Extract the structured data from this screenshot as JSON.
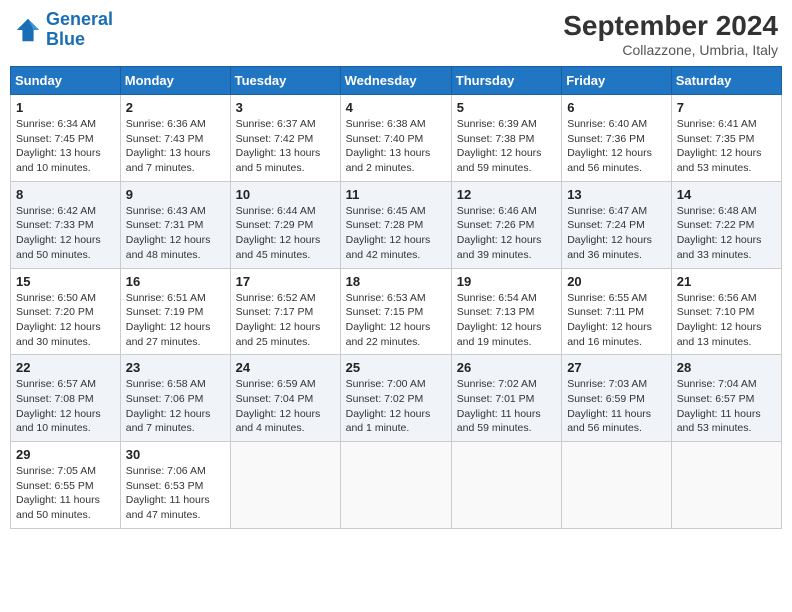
{
  "header": {
    "logo_line1": "General",
    "logo_line2": "Blue",
    "month": "September 2024",
    "location": "Collazzone, Umbria, Italy"
  },
  "days_of_week": [
    "Sunday",
    "Monday",
    "Tuesday",
    "Wednesday",
    "Thursday",
    "Friday",
    "Saturday"
  ],
  "weeks": [
    [
      {
        "day": "1",
        "sunrise": "6:34 AM",
        "sunset": "7:45 PM",
        "daylight": "13 hours and 10 minutes."
      },
      {
        "day": "2",
        "sunrise": "6:36 AM",
        "sunset": "7:43 PM",
        "daylight": "13 hours and 7 minutes."
      },
      {
        "day": "3",
        "sunrise": "6:37 AM",
        "sunset": "7:42 PM",
        "daylight": "13 hours and 5 minutes."
      },
      {
        "day": "4",
        "sunrise": "6:38 AM",
        "sunset": "7:40 PM",
        "daylight": "13 hours and 2 minutes."
      },
      {
        "day": "5",
        "sunrise": "6:39 AM",
        "sunset": "7:38 PM",
        "daylight": "12 hours and 59 minutes."
      },
      {
        "day": "6",
        "sunrise": "6:40 AM",
        "sunset": "7:36 PM",
        "daylight": "12 hours and 56 minutes."
      },
      {
        "day": "7",
        "sunrise": "6:41 AM",
        "sunset": "7:35 PM",
        "daylight": "12 hours and 53 minutes."
      }
    ],
    [
      {
        "day": "8",
        "sunrise": "6:42 AM",
        "sunset": "7:33 PM",
        "daylight": "12 hours and 50 minutes."
      },
      {
        "day": "9",
        "sunrise": "6:43 AM",
        "sunset": "7:31 PM",
        "daylight": "12 hours and 48 minutes."
      },
      {
        "day": "10",
        "sunrise": "6:44 AM",
        "sunset": "7:29 PM",
        "daylight": "12 hours and 45 minutes."
      },
      {
        "day": "11",
        "sunrise": "6:45 AM",
        "sunset": "7:28 PM",
        "daylight": "12 hours and 42 minutes."
      },
      {
        "day": "12",
        "sunrise": "6:46 AM",
        "sunset": "7:26 PM",
        "daylight": "12 hours and 39 minutes."
      },
      {
        "day": "13",
        "sunrise": "6:47 AM",
        "sunset": "7:24 PM",
        "daylight": "12 hours and 36 minutes."
      },
      {
        "day": "14",
        "sunrise": "6:48 AM",
        "sunset": "7:22 PM",
        "daylight": "12 hours and 33 minutes."
      }
    ],
    [
      {
        "day": "15",
        "sunrise": "6:50 AM",
        "sunset": "7:20 PM",
        "daylight": "12 hours and 30 minutes."
      },
      {
        "day": "16",
        "sunrise": "6:51 AM",
        "sunset": "7:19 PM",
        "daylight": "12 hours and 27 minutes."
      },
      {
        "day": "17",
        "sunrise": "6:52 AM",
        "sunset": "7:17 PM",
        "daylight": "12 hours and 25 minutes."
      },
      {
        "day": "18",
        "sunrise": "6:53 AM",
        "sunset": "7:15 PM",
        "daylight": "12 hours and 22 minutes."
      },
      {
        "day": "19",
        "sunrise": "6:54 AM",
        "sunset": "7:13 PM",
        "daylight": "12 hours and 19 minutes."
      },
      {
        "day": "20",
        "sunrise": "6:55 AM",
        "sunset": "7:11 PM",
        "daylight": "12 hours and 16 minutes."
      },
      {
        "day": "21",
        "sunrise": "6:56 AM",
        "sunset": "7:10 PM",
        "daylight": "12 hours and 13 minutes."
      }
    ],
    [
      {
        "day": "22",
        "sunrise": "6:57 AM",
        "sunset": "7:08 PM",
        "daylight": "12 hours and 10 minutes."
      },
      {
        "day": "23",
        "sunrise": "6:58 AM",
        "sunset": "7:06 PM",
        "daylight": "12 hours and 7 minutes."
      },
      {
        "day": "24",
        "sunrise": "6:59 AM",
        "sunset": "7:04 PM",
        "daylight": "12 hours and 4 minutes."
      },
      {
        "day": "25",
        "sunrise": "7:00 AM",
        "sunset": "7:02 PM",
        "daylight": "12 hours and 1 minute."
      },
      {
        "day": "26",
        "sunrise": "7:02 AM",
        "sunset": "7:01 PM",
        "daylight": "11 hours and 59 minutes."
      },
      {
        "day": "27",
        "sunrise": "7:03 AM",
        "sunset": "6:59 PM",
        "daylight": "11 hours and 56 minutes."
      },
      {
        "day": "28",
        "sunrise": "7:04 AM",
        "sunset": "6:57 PM",
        "daylight": "11 hours and 53 minutes."
      }
    ],
    [
      {
        "day": "29",
        "sunrise": "7:05 AM",
        "sunset": "6:55 PM",
        "daylight": "11 hours and 50 minutes."
      },
      {
        "day": "30",
        "sunrise": "7:06 AM",
        "sunset": "6:53 PM",
        "daylight": "11 hours and 47 minutes."
      },
      null,
      null,
      null,
      null,
      null
    ]
  ]
}
